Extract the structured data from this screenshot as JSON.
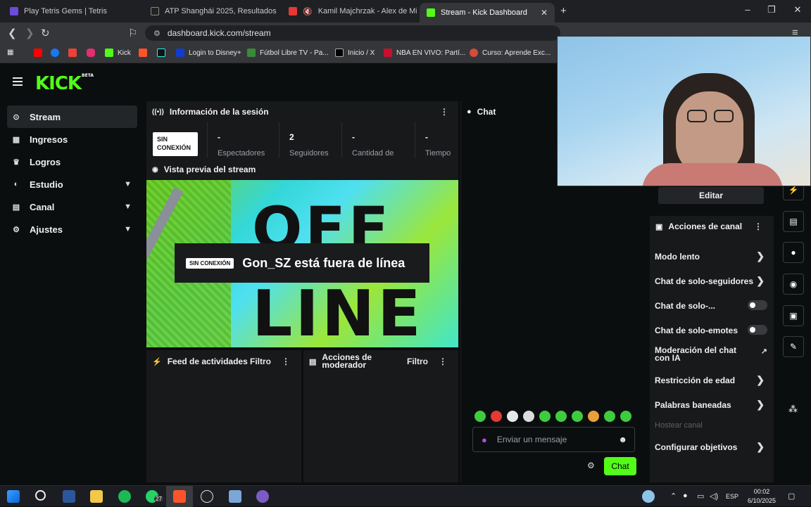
{
  "browser": {
    "tabs": [
      {
        "title": "Play Tetris Gems | Tetris",
        "color": "#6b4bd8"
      },
      {
        "title": "ATP Shanghái 2025, Resultados de Te",
        "color": "#222222"
      },
      {
        "title": "Kamil Majchrzak - Alex de Minau",
        "color": "#e53935"
      },
      {
        "title": "Stream - Kick Dashboard",
        "color": "#53fc18"
      }
    ],
    "new_tab": "+",
    "url": "dashboard.kick.com/stream",
    "bookmarks": [
      {
        "label": "",
        "color": "#ff0000"
      },
      {
        "label": "",
        "color": "#1877f2"
      },
      {
        "label": "",
        "color": "#ea4335"
      },
      {
        "label": "",
        "color": "#e1306c"
      },
      {
        "label": "Kick",
        "color": "#53fc18"
      },
      {
        "label": "",
        "color": "#fb542b"
      },
      {
        "label": "",
        "color": "#25f4ee"
      },
      {
        "label": "Login to Disney+",
        "color": "#113ccf"
      },
      {
        "label": "Fútbol Libre TV - Pa...",
        "color": "#3a8a3a"
      },
      {
        "label": "Inicio / X",
        "color": "#000000"
      },
      {
        "label": "NBA EN VIVO: Partí...",
        "color": "#c8102e"
      },
      {
        "label": "Curso: Aprende Exc...",
        "color": "#d44c3a"
      }
    ]
  },
  "sidebar": {
    "items": [
      {
        "label": "Stream",
        "icon": "stream-icon",
        "glyph": "⊙",
        "active": true
      },
      {
        "label": "Ingresos",
        "icon": "revenue-icon",
        "glyph": "▦",
        "active": false
      },
      {
        "label": "Logros",
        "icon": "trophy-icon",
        "glyph": "🏆",
        "active": false
      },
      {
        "label": "Estudio",
        "icon": "studio-icon",
        "glyph": "◐",
        "active": false,
        "expandable": true
      },
      {
        "label": "Canal",
        "icon": "channel-icon",
        "glyph": "▤",
        "active": false,
        "expandable": true
      },
      {
        "label": "Ajustes",
        "icon": "gear-icon",
        "glyph": "⚙",
        "active": false,
        "expandable": true
      }
    ]
  },
  "session": {
    "title": "Información de la sesión",
    "status_badge": "SIN CONEXIÓN",
    "stats": [
      {
        "value": "-",
        "label": "Espectadores"
      },
      {
        "value": "2",
        "label": "Seguidores"
      },
      {
        "value": "-",
        "label": "Cantidad de"
      },
      {
        "value": "-",
        "label": "Tiempo"
      }
    ]
  },
  "preview": {
    "title": "Vista previa del stream",
    "word_top": "OFF",
    "word_bottom": "LINE",
    "badge": "SIN CONEXIÓN",
    "message": "Gon_SZ está fuera de línea"
  },
  "activity_feed": {
    "title": "Feed de actividades",
    "filter": "Filtro"
  },
  "mod_actions": {
    "title": "Acciones de moderador",
    "filter": "Filtro"
  },
  "chat": {
    "title": "Chat",
    "placeholder": "Enviar un mensaje",
    "send": "Chat",
    "emote_colors": [
      "#3ecc3e",
      "#e53935",
      "#e8e8e8",
      "#e8e8e8",
      "#3ecc3e",
      "#3ecc3e",
      "#3ecc3e",
      "#3ecc3e",
      "#e8a03a",
      "#3ecc3e",
      "#3ecc3e"
    ]
  },
  "channel": {
    "edit_button": "Editar",
    "actions_title": "Acciones de canal",
    "actions": [
      {
        "label": "Modo lento",
        "type": "arrow"
      },
      {
        "label": "Chat de solo-seguidores",
        "type": "arrow"
      },
      {
        "label": "Chat de solo-...",
        "type": "toggle"
      },
      {
        "label": "Chat de solo-emotes",
        "type": "toggle"
      },
      {
        "label": "Moderación del chat con IA",
        "type": "external"
      },
      {
        "label": "Restricción de edad",
        "type": "arrow"
      },
      {
        "label": "Palabras baneadas",
        "type": "arrow"
      },
      {
        "label": "Hostear canal",
        "type": "disabled"
      },
      {
        "label": "Configurar objetivos",
        "type": "arrow"
      }
    ]
  },
  "right_rail": [
    "flash-icon",
    "document-icon",
    "chat-bubble-icon",
    "broadcast-icon",
    "layout-icon",
    "wrench-icon",
    "share-icon"
  ],
  "taskbar": {
    "badge_whatsapp": "27",
    "lang": "ESP",
    "time": "00:02",
    "date": "6/10/2025"
  }
}
